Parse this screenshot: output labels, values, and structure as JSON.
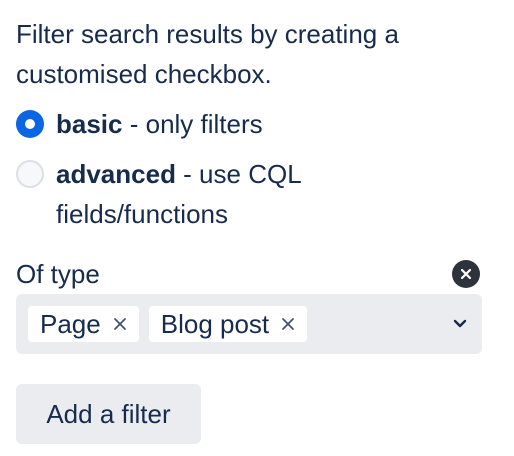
{
  "intro": "Filter search results by creating a customised checkbox.",
  "mode": {
    "options": [
      {
        "label": "basic",
        "description": " - only filters",
        "checked": true
      },
      {
        "label": "advanced",
        "description": " - use CQL fields/functions",
        "checked": false
      }
    ]
  },
  "type_filter": {
    "label": "Of type",
    "clear_icon": "clear-circle-icon",
    "chips": [
      {
        "label": "Page",
        "remove_icon": "close-icon"
      },
      {
        "label": "Blog post",
        "remove_icon": "close-icon"
      }
    ],
    "dropdown_icon": "chevron-down-icon"
  },
  "add_filter_label": "Add a filter",
  "colors": {
    "accent": "#0c66e4",
    "text": "#172b4d",
    "field_bg": "#ebecf0"
  }
}
